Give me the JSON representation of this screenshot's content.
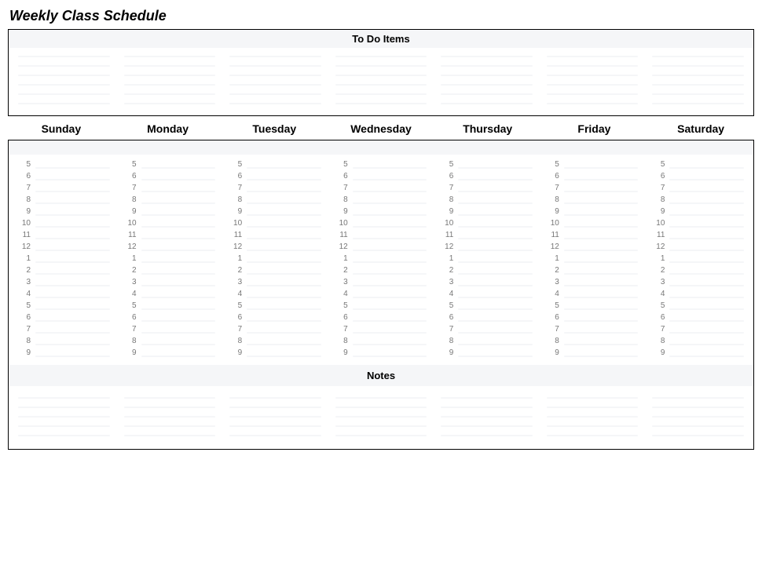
{
  "title": "Weekly Class Schedule",
  "todo": {
    "header": "To Do Items",
    "columns": 7,
    "lines_per_column": 6
  },
  "days": [
    "Sunday",
    "Monday",
    "Tuesday",
    "Wednesday",
    "Thursday",
    "Friday",
    "Saturday"
  ],
  "hours": [
    "5",
    "6",
    "7",
    "8",
    "9",
    "10",
    "11",
    "12",
    "1",
    "2",
    "3",
    "4",
    "5",
    "6",
    "7",
    "8",
    "9"
  ],
  "notes": {
    "header": "Notes",
    "columns": 7,
    "lines_per_column": 5
  }
}
